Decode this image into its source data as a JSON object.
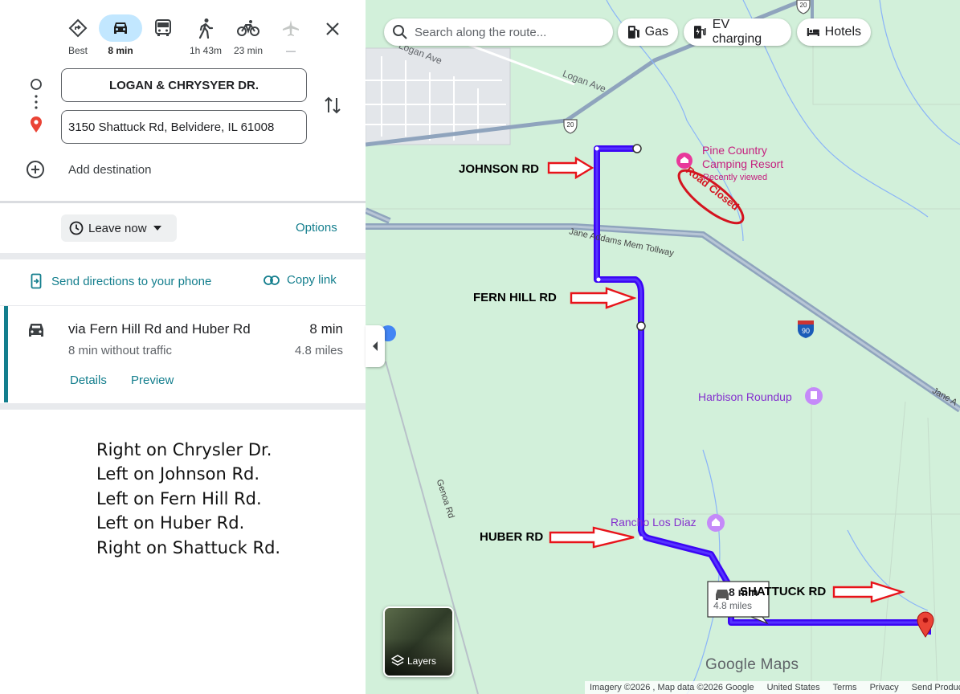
{
  "travel_modes": [
    {
      "name": "best",
      "label": "Best"
    },
    {
      "name": "drive",
      "label": "8 min"
    },
    {
      "name": "transit",
      "label": ""
    },
    {
      "name": "walk",
      "label": "1h 43m"
    },
    {
      "name": "bike",
      "label": "23 min"
    },
    {
      "name": "flight",
      "label": "—"
    }
  ],
  "origin": "LOGAN & CHRYSYER DR.",
  "destination": "3150 Shattuck Rd, Belvidere, IL 61008",
  "add_destination": "Add destination",
  "leave_now": "Leave now",
  "options": "Options",
  "send_to_phone": "Send directions to your phone",
  "copy_link": "Copy link",
  "route": {
    "via": "via Fern Hill Rd and Huber Rd",
    "time": "8 min",
    "traffic": "8 min without traffic",
    "distance": "4.8 miles",
    "details": "Details",
    "preview": "Preview"
  },
  "instructions": [
    "Right on Chrysler Dr.",
    "Left on Johnson Rd.",
    "Left on Fern Hill Rd.",
    "Left on Huber Rd.",
    "Right on Shattuck Rd."
  ],
  "map": {
    "search_placeholder": "Search along the route...",
    "chips": [
      "Gas",
      "EV charging",
      "Hotels"
    ],
    "annotations": [
      "JOHNSON RD",
      "FERN HILL RD",
      "HUBER RD",
      "SHATTUCK RD"
    ],
    "road_closed": "Road Closed",
    "places": {
      "pine_country": "Pine Country\nCamping Resort",
      "recently_viewed": "Recently viewed",
      "harbison": "Harbison Roundup",
      "rancho": "Rancho Los Diaz"
    },
    "roads": {
      "logan1": "Logan Ave",
      "logan2": "Logan Ave",
      "jane": "Jane Addams Mem Tollway",
      "jane2": "Jane A",
      "genoa": "Genoa Rd",
      "us20a": "20",
      "us20b": "20",
      "i90": "90"
    },
    "route_box": {
      "time": "8 min",
      "distance": "4.8 miles"
    },
    "layers": "Layers",
    "logo": "Google Maps",
    "footer": [
      "Imagery ©2026 , Map data ©2026 Google",
      "United States",
      "Terms",
      "Privacy",
      "Send Product Feedback"
    ],
    "colors": {
      "route": "#3b05f5",
      "map_bg": "#d2f0da",
      "arrow": "#e8131a",
      "accent": "#0b57d0",
      "teal": "#137e8d"
    }
  }
}
